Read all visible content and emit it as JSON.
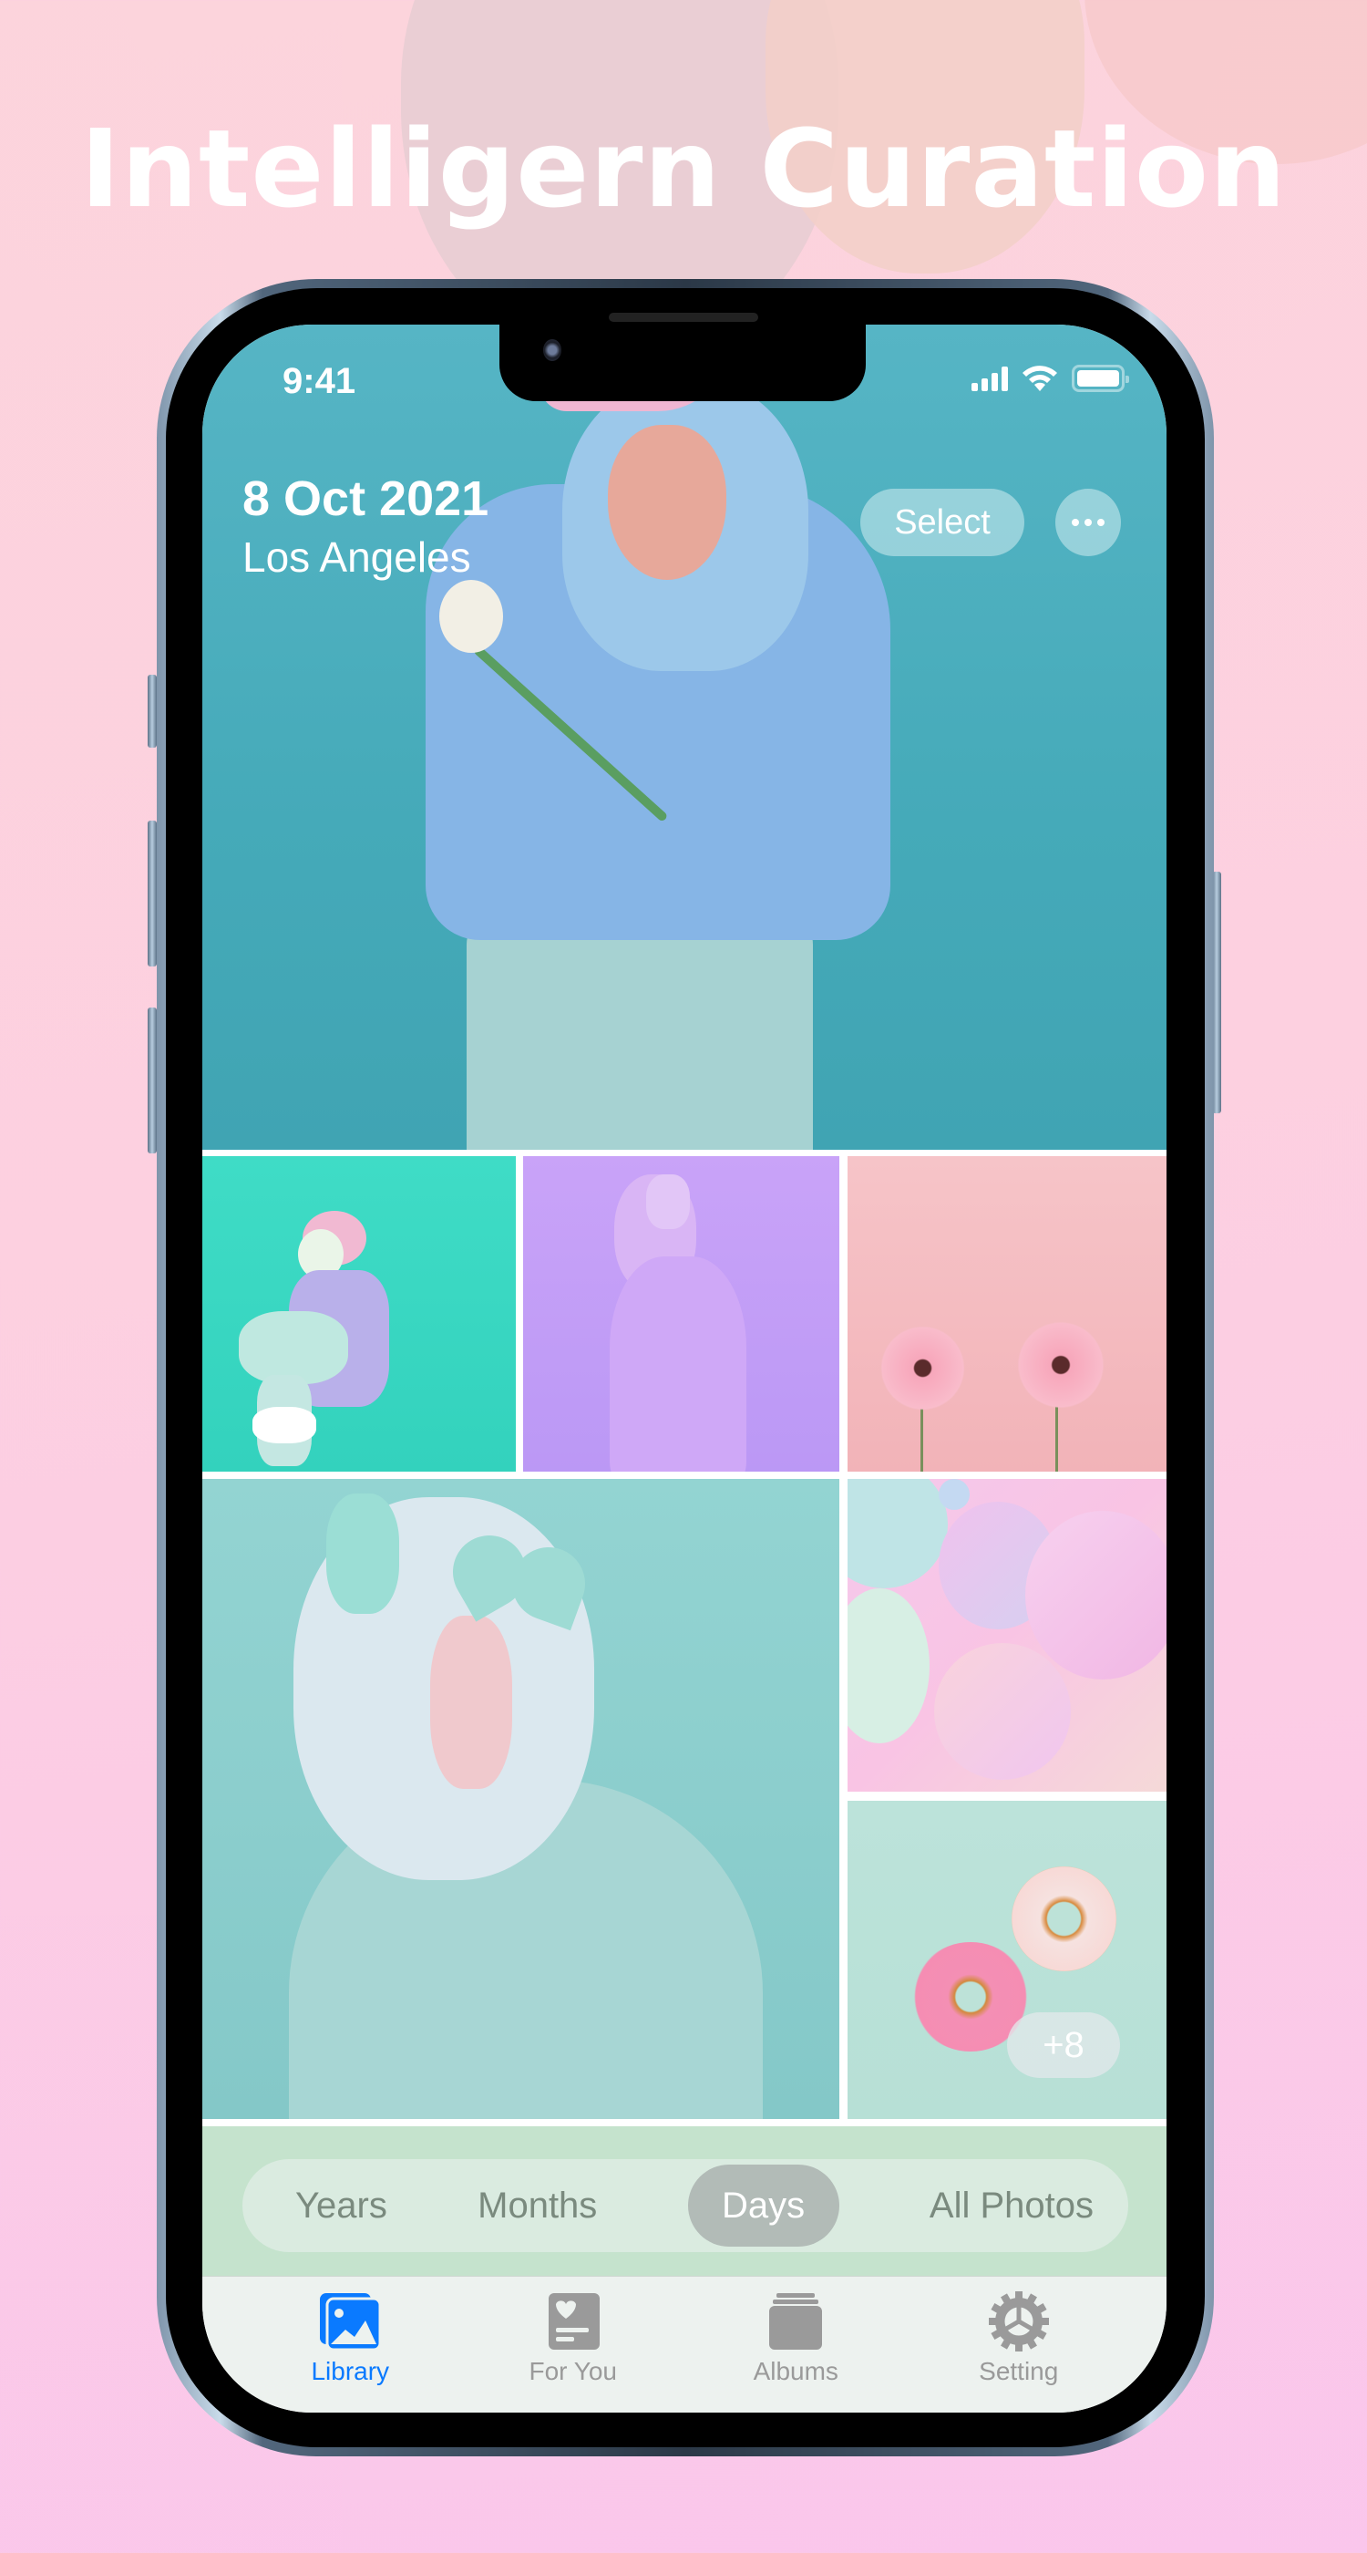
{
  "headline": "Intelligern Curation",
  "status_bar": {
    "time": "9:41",
    "icons": [
      "cellular-signal-icon",
      "wifi-icon",
      "battery-icon"
    ]
  },
  "header": {
    "date": "8 Oct 2021",
    "location": "Los Angeles",
    "select_label": "Select",
    "more_icon": "ellipsis-icon"
  },
  "photos": [
    {
      "subject": "woman in pink cap holding rose",
      "background": "#45aab9"
    },
    {
      "subject": "woman with rose, teal backdrop",
      "background": "#3fdcc6"
    },
    {
      "subject": "woman with headphones, lilac backdrop",
      "background": "#c9a3f8"
    },
    {
      "subject": "two pink gerbera daisies",
      "background": "#f4bcc1"
    },
    {
      "subject": "woman with heart sunglasses and headphones",
      "background": "#8ccece"
    },
    {
      "subject": "pastel balloons",
      "background": "#f7c7e8"
    },
    {
      "subject": "flying donuts with sprinkles",
      "background": "#bae2d8",
      "overlay_count": "+8"
    }
  ],
  "segmented_control": {
    "items": [
      "Years",
      "Months",
      "Days",
      "All Photos"
    ],
    "selected": "Days"
  },
  "tabbar": {
    "items": [
      {
        "label": "Library",
        "icon": "photo-library-icon",
        "active": true
      },
      {
        "label": "For You",
        "icon": "for-you-heart-card-icon",
        "active": false
      },
      {
        "label": "Albums",
        "icon": "albums-stack-icon",
        "active": false
      },
      {
        "label": "Setting",
        "icon": "gear-icon",
        "active": false
      }
    ]
  },
  "colors": {
    "accent": "#0a7aff",
    "inactive": "#9a9a9a",
    "segment_bg": "#c5e3cd",
    "segment_active": "#b2bbb7"
  }
}
